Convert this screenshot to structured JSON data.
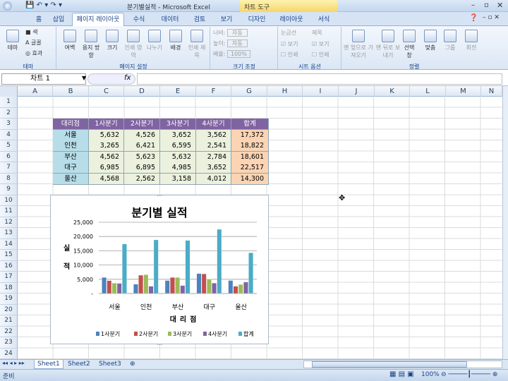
{
  "window": {
    "title": "분기별실적 - Microsoft Excel",
    "context_tab": "차트 도구"
  },
  "tabs": [
    "홈",
    "삽입",
    "페이지 레이아웃",
    "수식",
    "데이터",
    "검토",
    "보기",
    "디자인",
    "레이아웃",
    "서식"
  ],
  "ribbon": {
    "groups": [
      {
        "label": "테마",
        "items": [
          "테마",
          "색",
          "글꼴",
          "효과"
        ]
      },
      {
        "label": "페이지 설정",
        "items": [
          "여백",
          "용지 방향",
          "크기",
          "인쇄 영역",
          "나누기",
          "배경",
          "인쇄 제목"
        ]
      },
      {
        "label": "크기 조정",
        "items": [
          "너비:",
          "높이:",
          "배율:",
          "자동",
          "자동",
          "100%"
        ]
      },
      {
        "label": "시트 옵션",
        "items": [
          "눈금선",
          "제목",
          "보기",
          "보기",
          "인쇄",
          "인쇄"
        ]
      },
      {
        "label": "정렬",
        "items": [
          "맨 앞으로 가져오기",
          "맨 뒤로 보내기",
          "선택 창",
          "맞춤",
          "그룹",
          "회전"
        ]
      }
    ]
  },
  "formula": {
    "name_box": "차트 1",
    "fx": "fx"
  },
  "columns": [
    "A",
    "B",
    "C",
    "D",
    "E",
    "F",
    "G",
    "H",
    "I",
    "J",
    "K",
    "L",
    "M",
    "N"
  ],
  "rows": [
    "1",
    "2",
    "3",
    "4",
    "5",
    "6",
    "7",
    "8",
    "9",
    "10",
    "11",
    "12",
    "13",
    "14",
    "15",
    "16",
    "17",
    "18",
    "19",
    "20",
    "21",
    "22",
    "23",
    "24"
  ],
  "table": {
    "headers": [
      "대리점",
      "1사분기",
      "2사분기",
      "3사분기",
      "4사분기",
      "합계"
    ],
    "rows": [
      [
        "서울",
        "5,632",
        "4,526",
        "3,652",
        "3,562",
        "17,372"
      ],
      [
        "인천",
        "3,265",
        "6,421",
        "6,595",
        "2,541",
        "18,822"
      ],
      [
        "부산",
        "4,562",
        "5,623",
        "5,632",
        "2,784",
        "18,601"
      ],
      [
        "대구",
        "6,985",
        "6,895",
        "4,985",
        "3,652",
        "22,517"
      ],
      [
        "울산",
        "4,568",
        "2,562",
        "3,158",
        "4,012",
        "14,300"
      ]
    ]
  },
  "chart_data": {
    "type": "bar",
    "title": "분기별 실적",
    "xlabel": "대리점",
    "ylabel": "실적",
    "categories": [
      "서울",
      "인천",
      "부산",
      "대구",
      "울산"
    ],
    "series": [
      {
        "name": "1사분기",
        "values": [
          5632,
          3265,
          4562,
          6985,
          4568
        ],
        "color": "#4f81bd"
      },
      {
        "name": "2사분기",
        "values": [
          4526,
          6421,
          5623,
          6895,
          2562
        ],
        "color": "#c0504d"
      },
      {
        "name": "3사분기",
        "values": [
          3652,
          6595,
          5632,
          4985,
          3158
        ],
        "color": "#9bbb59"
      },
      {
        "name": "4사분기",
        "values": [
          3562,
          2541,
          2784,
          3652,
          4012
        ],
        "color": "#8064a2"
      },
      {
        "name": "합계",
        "values": [
          17372,
          18822,
          18601,
          22517,
          14300
        ],
        "color": "#4bacc6"
      }
    ],
    "ylim": [
      0,
      25000
    ],
    "yticks": [
      "-",
      "5,000",
      "10,000",
      "15,000",
      "20,000",
      "25,000"
    ],
    "grid": true,
    "legend": "bottom"
  },
  "sheets": [
    "Sheet1",
    "Sheet2",
    "Sheet3"
  ],
  "status": {
    "ready": "준비",
    "zoom": "100%"
  }
}
